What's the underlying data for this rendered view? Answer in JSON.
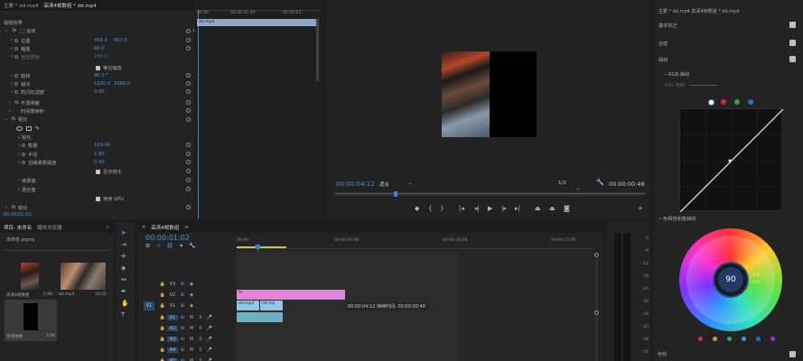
{
  "effect_controls": {
    "tabs": [
      "主要 * dd.mp4",
      "高清4帧数组 * dd.mp4"
    ],
    "video_effects": "视频效果",
    "motion": "运动",
    "rows": [
      {
        "label": "位置",
        "v1": "458.0",
        "v2": "857.0"
      },
      {
        "label": "缩放",
        "v1": "60.0",
        "v2": ""
      },
      {
        "label": "缩放宽度",
        "v1": "100.0",
        "v2": ""
      },
      {
        "label": "等比缩放",
        "v1": "",
        "v2": ""
      },
      {
        "label": "旋转",
        "v1": "90.0 °",
        "v2": ""
      },
      {
        "label": "锚点",
        "v1": "1920.0",
        "v2": "1080.0"
      },
      {
        "label": "防闪烁滤镜",
        "v1": "0.00",
        "v2": ""
      }
    ],
    "opacity": "不透明度",
    "time_remap": "时间重映射",
    "sharpen": "锐化",
    "sharpen_sub": "锐化",
    "sharpen_rows": [
      {
        "label": "数量",
        "value": "169.00"
      },
      {
        "label": "半径",
        "value": "1.80"
      },
      {
        "label": "边缘遮罩阈值",
        "value": "0.00"
      }
    ],
    "show_edge": "显示锐化",
    "mask_blur": "遮罩值",
    "mix": "混合值",
    "use_gpu": "使用 GPU",
    "sharpen2": "锐化",
    "timecode": "00:00:01:02",
    "mini_timeline": {
      "ticks": [
        "00:00",
        "00:00:01:30",
        "00:00:03"
      ],
      "clip_label": "dd.mp4"
    }
  },
  "program_monitor": {
    "timecode": "00:00:04:12",
    "fit": "适合",
    "quality": "1/2",
    "duration": "00:00:00:48"
  },
  "project": {
    "tabs": [
      "项目: 未命名",
      "媒体浏览器"
    ],
    "filename": "未命名.prproj",
    "items": [
      {
        "name": "高清4帧数组",
        "meta": "5:06"
      },
      {
        "name": "dd.mp4",
        "meta": "10:02"
      },
      {
        "name": "黑场视频",
        "meta": "5:06"
      }
    ]
  },
  "timeline": {
    "tab": "高清4帧数组",
    "timecode": "00:00:01:02",
    "ruler": [
      "00:00",
      "00:00:05:00",
      "00:00:10:00",
      "00:00:15:00"
    ],
    "video_tracks": [
      "V3",
      "V2",
      "V1"
    ],
    "audio_tracks": [
      "A1",
      "A2",
      "A3",
      "A4",
      "A5"
    ],
    "source_label": "V1",
    "tooltip": "00:00:04:12  持续时间: 00:00:00:48",
    "clips": {
      "v2": "fx",
      "v1": "dd.mp4",
      "v1b": "dd.mp"
    }
  },
  "lumetri": {
    "header": "主要 * dd.mp4  高清4帧数组 * dd.mp4",
    "sections": [
      "基本校正",
      "创意",
      "曲线"
    ],
    "rgb_curves": "RGB 曲线",
    "hue_sat": "HSL 饱和",
    "hue_sat_curve": "色相饱和度曲线",
    "wheel_readout": "90",
    "wheel_small": [
      "0.5",
      "0.5"
    ],
    "bottom_section": "色轮",
    "curve_swatches": [
      "#ffffff",
      "#d23030",
      "#2ea04a",
      "#2f6fd6"
    ],
    "wheel_swatches": [
      "#d23030",
      "#c8a030",
      "#3aa84a",
      "#30a8c8",
      "#3060d0",
      "#a030c8"
    ]
  },
  "audio_meter": {
    "labels": [
      "0",
      "-6",
      "-12",
      "-18",
      "-24",
      "-30",
      "-36",
      "-42",
      "-48",
      "-54"
    ]
  }
}
